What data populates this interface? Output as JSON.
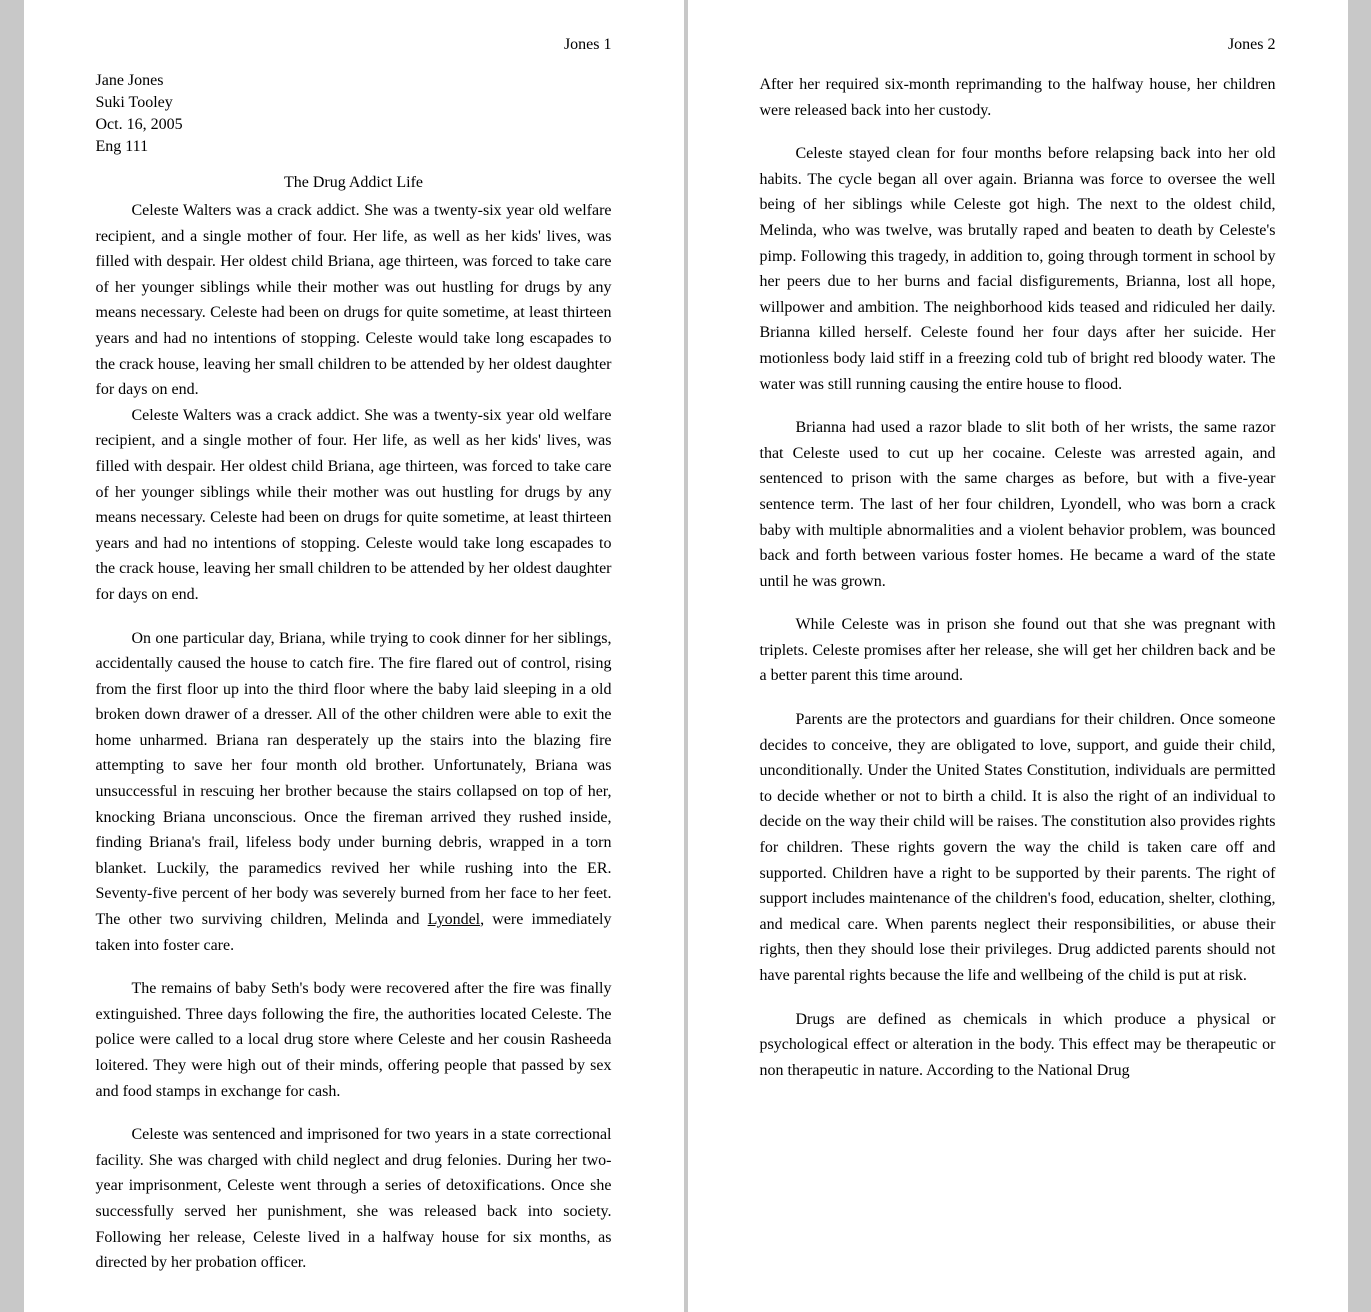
{
  "page1": {
    "header": "Jones 1",
    "author": {
      "name": "Jane Jones",
      "instructor": "Suki Tooley",
      "date": "Oct. 16, 2005",
      "course": "Eng 111"
    },
    "title": "The Drug Addict Life",
    "paragraphs": [
      {
        "indented": true,
        "text": "Celeste Walters was a crack addict.  She was a twenty-six year old welfare recipient, and a single mother of four. Her life, as well as her kids' lives, was filled with despair.  Her oldest child Briana, age thirteen, was forced to take care of her younger siblings while their mother was out hustling for drugs by any means necessary. Celeste had been on drugs for quite sometime, at least thirteen years and had no intentions of stopping. Celeste would take long escapades to the crack house, leaving her small children to be attended by her oldest daughter for days on end."
      },
      {
        "indented": true,
        "text": "On one particular day, Briana, while trying to cook dinner for her siblings, accidentally caused the house to catch fire. The fire flared out of control, rising from the first floor up into the third floor where the baby laid sleeping in a old broken down drawer of a dresser. All of the other children were able to exit the home unharmed. Briana ran desperately up the stairs into the blazing fire attempting to save her four month old brother. Unfortunately, Briana was unsuccessful in rescuing her brother because the stairs collapsed on top of her, knocking Briana unconscious. Once the fireman arrived they rushed inside, finding Briana's frail, lifeless body under burning debris, wrapped in a torn blanket. Luckily, the paramedics revived her while rushing into the ER. Seventy-five percent of her body was severely burned from her face to her feet. The other two surviving children, Melinda and Lyondel, were immediately taken into foster care.",
        "underline_word": "Lyondel"
      },
      {
        "indented": false,
        "text": "    The remains of baby Seth's body were recovered after the fire was finally extinguished. Three days following the fire, the authorities located Celeste. The police were called to a local drug store where Celeste and her cousin Rasheeda loitered. They were high out of their minds, offering people that passed by sex and food stamps in exchange for cash."
      },
      {
        "indented": false,
        "text": "    Celeste was sentenced and imprisoned for two years in a state correctional facility. She was charged with child neglect and drug felonies. During her two-year imprisonment, Celeste went through a series of detoxifications.  Once she successfully served her punishment, she was released back into society. Following her release, Celeste lived in a halfway house for six months, as directed by her probation officer."
      }
    ]
  },
  "page2": {
    "header": "Jones 2",
    "paragraphs": [
      {
        "indented": false,
        "text": "After her required six-month reprimanding to the halfway house, her children were released back into her custody."
      },
      {
        "indented": true,
        "text": "Celeste stayed clean for four months before relapsing back into her old habits. The cycle began all over again. Brianna was force to oversee the well being of her siblings while Celeste got high. The next to the oldest child, Melinda, who was twelve, was brutally raped and beaten to death by Celeste's pimp. Following this tragedy, in addition to, going through torment in school by her peers due to her burns and facial disfigurements, Brianna, lost all hope, willpower and ambition. The neighborhood kids teased and ridiculed her daily. Brianna killed herself. Celeste found her four days after her suicide. Her motionless body laid stiff in a freezing cold tub of bright red bloody water. The water was still running causing the entire house to flood."
      },
      {
        "indented": true,
        "text": "Brianna had used a razor blade to slit both of her wrists, the same razor that Celeste used to cut up her cocaine. Celeste was arrested again, and sentenced to prison with the same charges as before, but with a five-year sentence term.  The last of her four children, Lyondell, who was born a crack baby with multiple abnormalities and a violent behavior problem, was bounced back and forth between various foster homes. He became a ward of the state until he was grown."
      },
      {
        "indented": true,
        "text": "While Celeste was in prison she found out that she was pregnant with triplets. Celeste promises after her release, she will get her children back and be a better parent this time around."
      },
      {
        "indented": true,
        "text": "Parents are the protectors and guardians for their children. Once someone decides to conceive, they are obligated to love, support, and guide their child, unconditionally. Under the United States Constitution, individuals are permitted to decide whether or not to birth a child. It is also the right of an individual to decide on the way their child will be raises. The constitution also provides rights for children. These rights govern the way the child is taken care off and supported.   Children have a right to be supported by their parents. The right of support includes maintenance of the children's food, education, shelter, clothing, and medical care. When parents neglect their responsibilities, or abuse their rights, then they should lose their privileges. Drug addicted parents should not have parental rights because the life and wellbeing of the child is put at risk."
      },
      {
        "indented": true,
        "text": "Drugs are defined as chemicals in which produce a physical or psychological effect or alteration in the body.  This effect may be therapeutic or non therapeutic in nature. According to the National Drug"
      }
    ]
  }
}
